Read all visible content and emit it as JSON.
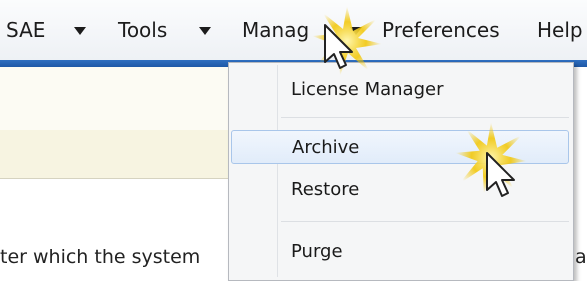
{
  "menubar": {
    "items": [
      {
        "label": "SAE",
        "has_caret": true
      },
      {
        "label": "Tools",
        "has_caret": true
      },
      {
        "label": "Manag",
        "has_caret": true
      },
      {
        "label": "Preferences",
        "has_caret": false
      },
      {
        "label": "Help",
        "has_caret": false
      }
    ]
  },
  "dropdown": {
    "items": [
      {
        "label": "License Manager"
      },
      {
        "label": "Archive",
        "highlighted": true
      },
      {
        "label": "Restore"
      },
      {
        "label": "Purge"
      }
    ]
  },
  "content": {
    "text": "ter which the system",
    "right_fragment": "a"
  },
  "colors": {
    "accent_strip": "#1e58a6",
    "highlight_border": "#a9c6ea",
    "glow": "#f2c500"
  }
}
